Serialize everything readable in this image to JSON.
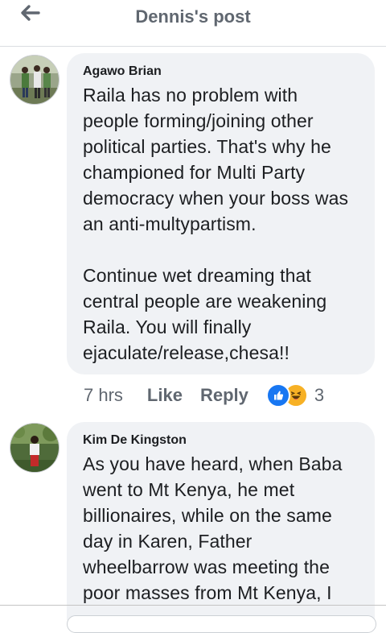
{
  "header": {
    "title": "Dennis's post",
    "back_icon": "left-arrow-icon"
  },
  "comments": [
    {
      "author": "Agawo Brian",
      "text": "Raila has no problem with\npeople forming/joining other\npolitical parties. That's why he\nchampioned for Multi Party\ndemocracy when your boss was\nan anti-multypartism.\n\nContinue wet dreaming that\ncentral people are weakening\nRaila. You will finally\nejaculate/release,chesa!!",
      "time": "7 hrs",
      "like_label": "Like",
      "reply_label": "Reply",
      "reactions": [
        "like-icon",
        "haha-icon"
      ],
      "reaction_count": "3"
    },
    {
      "author": "Kim De Kingston",
      "text": "As you have heard, when Baba\nwent to Mt Kenya, he met\nbillionaires, while on the same\nday in Karen, Father\nwheelbarrow was meeting the\npoor masses from Mt Kenya, I"
    }
  ],
  "colors": {
    "bubble": "#f0f2f5",
    "muted_text": "#606770",
    "like_blue": "#1877f2",
    "haha_yellow": "#f7b125"
  }
}
